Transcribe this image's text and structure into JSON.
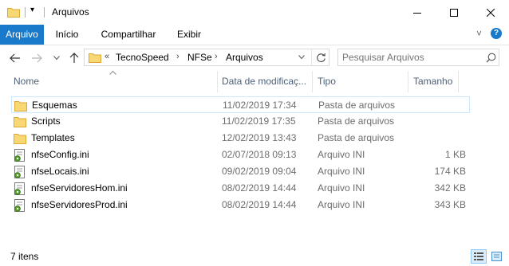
{
  "window": {
    "title": "Arquivos",
    "quick_access_chevron": "▾",
    "minimize_glyph": "—",
    "maximize_glyph": "☐",
    "close_glyph": "✕"
  },
  "ribbon": {
    "tabs": [
      "Arquivo",
      "Início",
      "Compartilhar",
      "Exibir"
    ],
    "active_tab": "Arquivo",
    "accent_color": "#1979ca",
    "expand_glyph": "˅",
    "help_glyph": "?"
  },
  "address": {
    "overflow": "«",
    "crumbs": [
      "TecnoSpeed",
      "NFSe",
      "Arquivos"
    ],
    "separator": "›",
    "search_placeholder": "Pesquisar Arquivos"
  },
  "columns": {
    "name": "Nome",
    "date": "Data de modificaç...",
    "type": "Tipo",
    "size": "Tamanho"
  },
  "files": [
    {
      "name": "Esquemas",
      "date": "11/02/2019 17:34",
      "type": "Pasta de arquivos",
      "size": "",
      "icon": "folder-icon",
      "selected": true
    },
    {
      "name": "Scripts",
      "date": "11/02/2019 17:35",
      "type": "Pasta de arquivos",
      "size": "",
      "icon": "folder-icon",
      "selected": false
    },
    {
      "name": "Templates",
      "date": "12/02/2019 13:43",
      "type": "Pasta de arquivos",
      "size": "",
      "icon": "folder-icon",
      "selected": false
    },
    {
      "name": "nfseConfig.ini",
      "date": "02/07/2018 09:13",
      "type": "Arquivo INI",
      "size": "1 KB",
      "icon": "ini-file-icon",
      "selected": false
    },
    {
      "name": "nfseLocais.ini",
      "date": "09/02/2019 09:04",
      "type": "Arquivo INI",
      "size": "174 KB",
      "icon": "ini-file-icon",
      "selected": false
    },
    {
      "name": "nfseServidoresHom.ini",
      "date": "08/02/2019 14:44",
      "type": "Arquivo INI",
      "size": "342 KB",
      "icon": "ini-file-icon",
      "selected": false
    },
    {
      "name": "nfseServidoresProd.ini",
      "date": "08/02/2019 14:44",
      "type": "Arquivo INI",
      "size": "343 KB",
      "icon": "ini-file-icon",
      "selected": false
    }
  ],
  "status": {
    "item_count": "7 itens"
  }
}
